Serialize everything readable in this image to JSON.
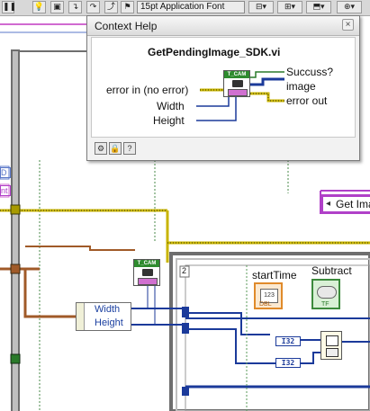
{
  "toolbar": {
    "font_menu_label": "15pt Application Font"
  },
  "context_help": {
    "title": "Context Help",
    "close_glyph": "×",
    "vi_name": "GetPendingImage_SDK.vi",
    "icon_header": "T_CAM",
    "terminals": {
      "error_in": "error in (no error)",
      "width": "Width",
      "height": "Height",
      "success": "Succuss?",
      "image": "image",
      "error_out": "error out"
    },
    "footer_buttons": [
      "gear-icon",
      "lock-icon",
      "question-icon"
    ],
    "footer_glyph_q": "?"
  },
  "diagram": {
    "subvi_header": "T_CAM",
    "bundle_fields": [
      "Width",
      "Height"
    ],
    "start_time_label": "startTime",
    "start_time_glyph": "123",
    "start_time_type": "DBL",
    "subtract_label": "Subtract",
    "subtract_type": "TF",
    "const_type": "I32",
    "get_image_label": "Get Ima",
    "frame_index": "2"
  },
  "colors": {
    "error_wire": "#c8b400",
    "integer_wire": "#1b3a9a",
    "refnum_wire": "#a05a28",
    "boolean_wire": "#2a7a2a",
    "frame_border": "#7a7a7a",
    "help_border": "#7c7c7c"
  }
}
